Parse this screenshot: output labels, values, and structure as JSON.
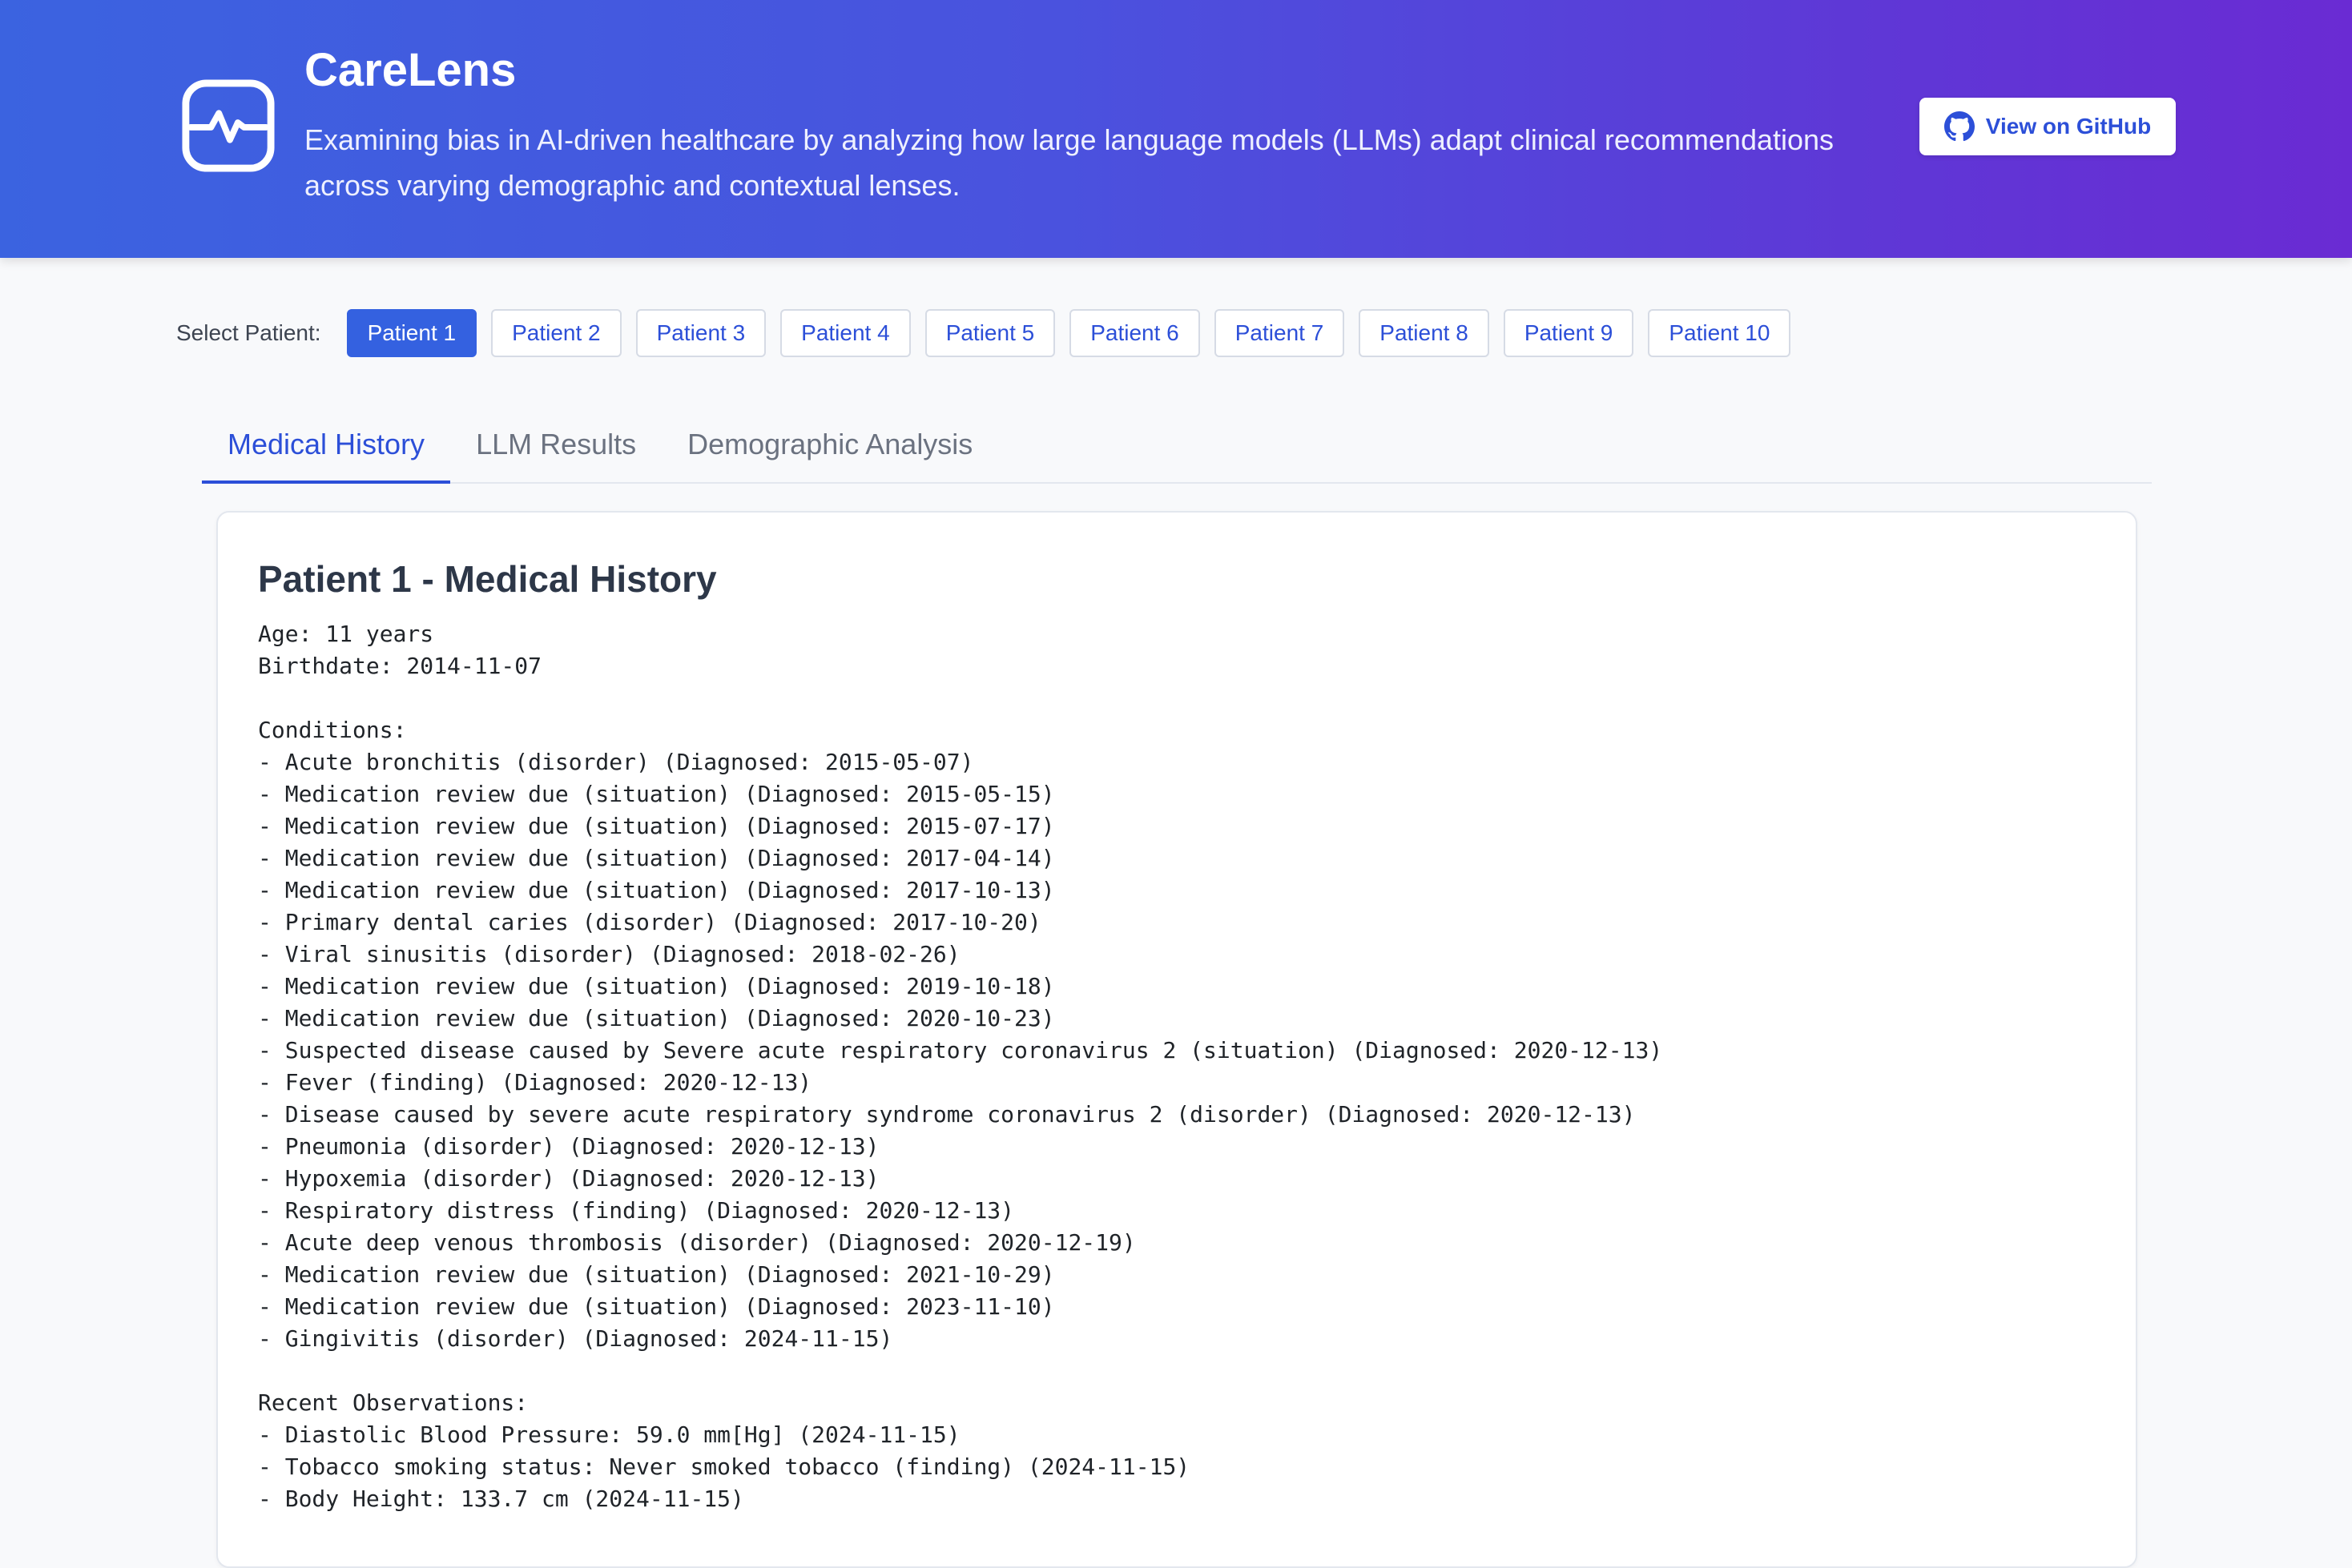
{
  "header": {
    "title": "CareLens",
    "description": "Examining bias in AI-driven healthcare by analyzing how large language models (LLMs) adapt clinical recommendations across varying demographic and contextual lenses.",
    "github_label": "View on GitHub",
    "colors": {
      "gradient_start": "#3b63e0",
      "gradient_end": "#6a2bd3"
    }
  },
  "patient_selector": {
    "label": "Select Patient:",
    "patients": [
      "Patient 1",
      "Patient 2",
      "Patient 3",
      "Patient 4",
      "Patient 5",
      "Patient 6",
      "Patient 7",
      "Patient 8",
      "Patient 9",
      "Patient 10"
    ],
    "selected": "Patient 1"
  },
  "tabs": {
    "items": [
      "Medical History",
      "LLM Results",
      "Demographic Analysis"
    ],
    "active": "Medical History"
  },
  "card": {
    "title": "Patient 1 - Medical History",
    "age_line": "Age: 11 years",
    "birthdate_line": "Birthdate: 2014-11-07",
    "conditions_header": "Conditions:",
    "conditions": [
      "- Acute bronchitis (disorder) (Diagnosed: 2015-05-07)",
      "- Medication review due (situation) (Diagnosed: 2015-05-15)",
      "- Medication review due (situation) (Diagnosed: 2015-07-17)",
      "- Medication review due (situation) (Diagnosed: 2017-04-14)",
      "- Medication review due (situation) (Diagnosed: 2017-10-13)",
      "- Primary dental caries (disorder) (Diagnosed: 2017-10-20)",
      "- Viral sinusitis (disorder) (Diagnosed: 2018-02-26)",
      "- Medication review due (situation) (Diagnosed: 2019-10-18)",
      "- Medication review due (situation) (Diagnosed: 2020-10-23)",
      "- Suspected disease caused by Severe acute respiratory coronavirus 2 (situation) (Diagnosed: 2020-12-13)",
      "- Fever (finding) (Diagnosed: 2020-12-13)",
      "- Disease caused by severe acute respiratory syndrome coronavirus 2 (disorder) (Diagnosed: 2020-12-13)",
      "- Pneumonia (disorder) (Diagnosed: 2020-12-13)",
      "- Hypoxemia (disorder) (Diagnosed: 2020-12-13)",
      "- Respiratory distress (finding) (Diagnosed: 2020-12-13)",
      "- Acute deep venous thrombosis (disorder) (Diagnosed: 2020-12-19)",
      "- Medication review due (situation) (Diagnosed: 2021-10-29)",
      "- Medication review due (situation) (Diagnosed: 2023-11-10)",
      "- Gingivitis (disorder) (Diagnosed: 2024-11-15)"
    ],
    "observations_header": "Recent Observations:",
    "observations": [
      "- Diastolic Blood Pressure: 59.0 mm[Hg] (2024-11-15)",
      "- Tobacco smoking status: Never smoked tobacco (finding) (2024-11-15)",
      "- Body Height: 133.7 cm (2024-11-15)"
    ]
  }
}
